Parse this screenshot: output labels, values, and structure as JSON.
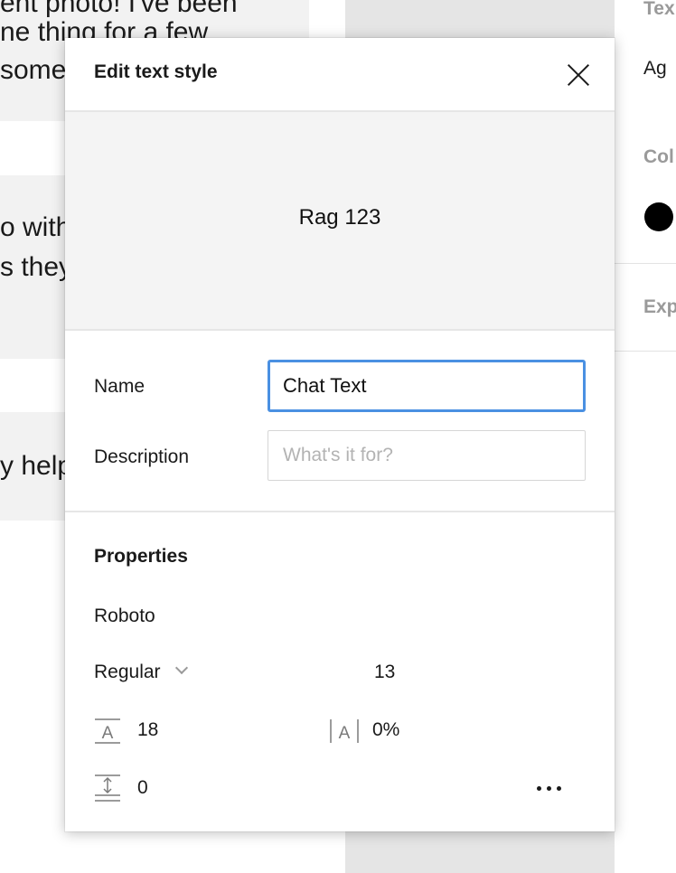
{
  "background": {
    "bubbles": [
      {
        "lines": [
          "ent photo! I've been",
          "ne thing for a few",
          "some"
        ]
      },
      {
        "lines": [
          "o with",
          "s they"
        ]
      },
      {
        "lines": [
          "y help"
        ]
      }
    ]
  },
  "right_panel": {
    "text_label": "Tex",
    "sample": "Ag",
    "color_label": "Col",
    "export_label": "Exp",
    "swatch_color": "#000000"
  },
  "modal": {
    "title": "Edit text style",
    "preview_text": "Rag 123",
    "name_label": "Name",
    "name_value": "Chat Text",
    "description_label": "Description",
    "description_placeholder": "What's it for?",
    "properties_heading": "Properties",
    "font_family": "Roboto",
    "font_weight": "Regular",
    "font_size": "13",
    "line_height": "18",
    "letter_spacing": "0%",
    "paragraph_spacing": "0",
    "icons": {
      "close": "close-icon",
      "weight_dropdown": "chevron-down-icon",
      "line_height": "line-height-icon",
      "letter_spacing": "letter-spacing-icon",
      "paragraph_spacing": "paragraph-spacing-icon",
      "more": "more-icon"
    }
  }
}
